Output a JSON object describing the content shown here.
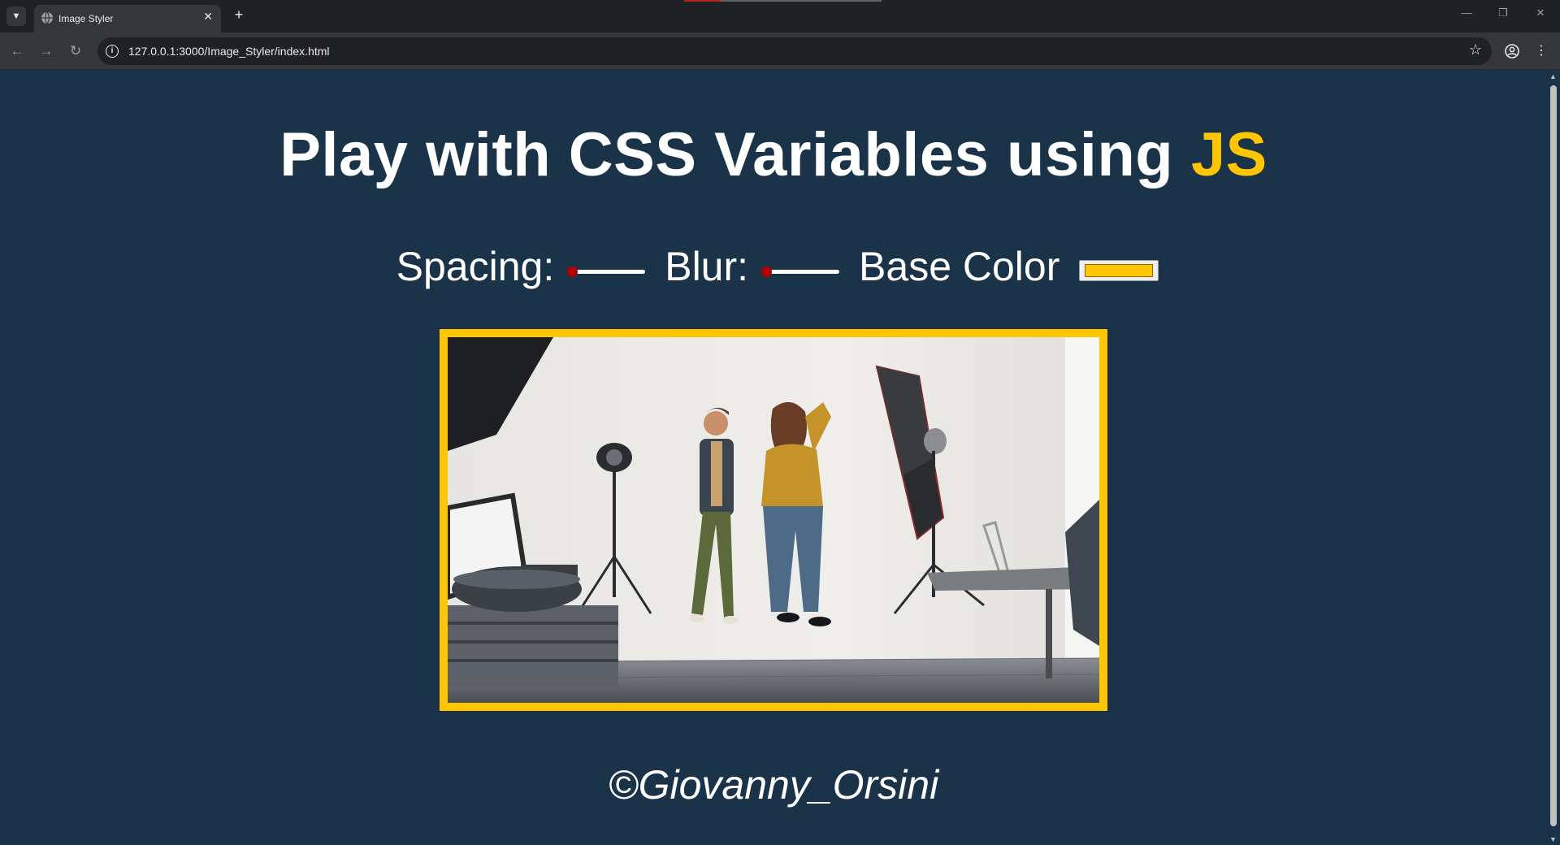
{
  "browser": {
    "tab_title": "Image Styler",
    "tab_close": "✕",
    "new_tab": "+",
    "url": "127.0.0.1:3000/Image_Styler/index.html",
    "icons": {
      "tab_menu": "chevron-down-icon",
      "favicon": "globe-icon",
      "back": "back-arrow-icon",
      "forward": "forward-arrow-icon",
      "reload": "reload-icon",
      "site_info": "info-icon",
      "bookmark": "star-icon",
      "profile": "profile-icon",
      "menu": "kebab-menu-icon",
      "minimize": "minimize-icon",
      "restore": "restore-icon",
      "close": "close-icon"
    }
  },
  "page": {
    "heading": "Play with CSS Variables using",
    "heading_highlight": "JS",
    "controls": {
      "spacing_label": "Spacing:",
      "spacing_value": 0,
      "blur_label": "Blur:",
      "blur_value": 0,
      "base_color_label": "Base Color",
      "base_color_value": "#ffc600"
    },
    "image_alt": "photo studio with photographer and model",
    "footer": "©Giovanny_Orsini"
  },
  "colors": {
    "background": "#1b3349",
    "accent": "#ffc600",
    "text": "#ffffff",
    "range_thumb": "#b00000"
  }
}
